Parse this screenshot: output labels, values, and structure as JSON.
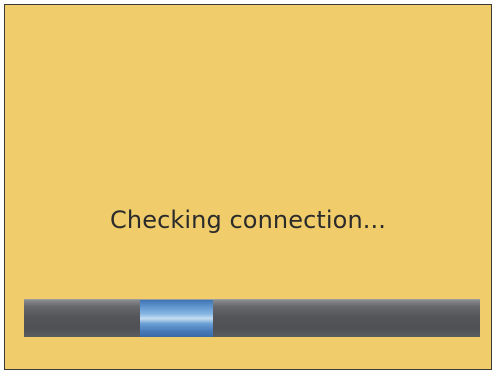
{
  "status": {
    "message": "Checking connection..."
  },
  "progress": {
    "mode": "indeterminate",
    "indicator_start_fraction": 0.255,
    "indicator_width_fraction": 0.16,
    "track_color": "#55565a",
    "indicator_color": "#5f95cf"
  },
  "colors": {
    "background": "#f0cd6a",
    "border": "#3a3a3a",
    "text": "#2b2b2b"
  }
}
